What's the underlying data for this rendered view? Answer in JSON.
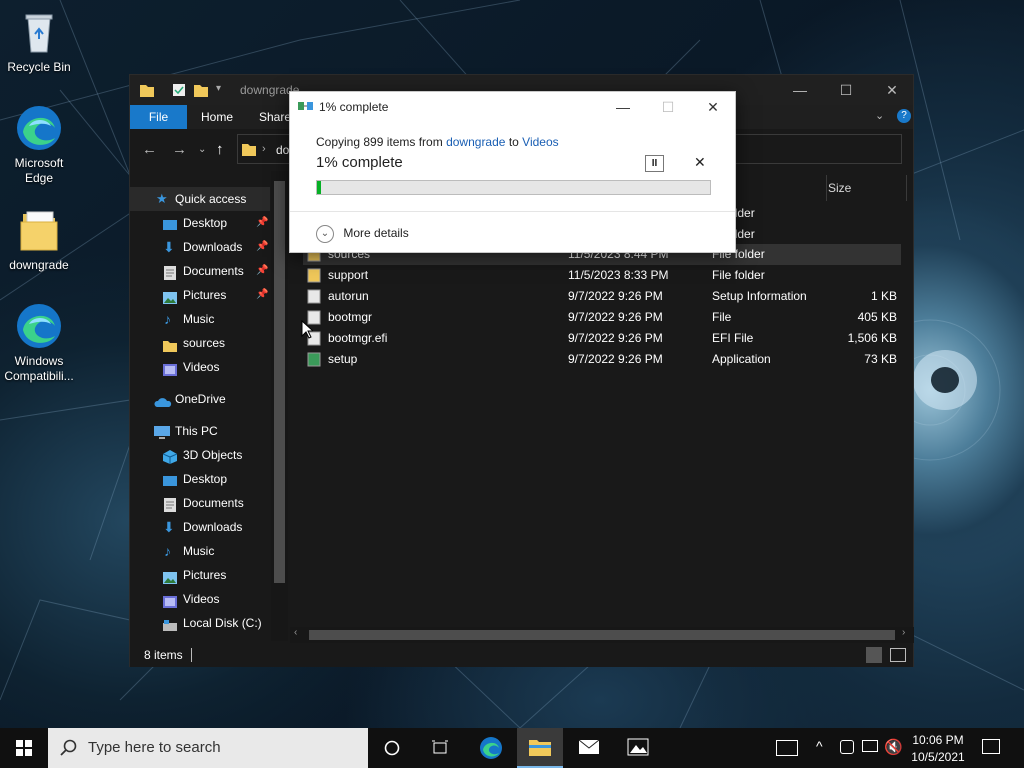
{
  "desktop": {
    "icons": [
      {
        "label": "Recycle Bin"
      },
      {
        "label": "Microsoft Edge"
      },
      {
        "label": "downgrade"
      },
      {
        "label": "Windows Compatibili..."
      }
    ]
  },
  "explorer": {
    "title": "downgrade",
    "address_partial": "do",
    "tabs": {
      "file": "File",
      "home": "Home",
      "share": "Share"
    },
    "columns": {
      "size": "Size"
    },
    "nav": {
      "quick_access": "Quick access",
      "qa_items": [
        "Desktop",
        "Downloads",
        "Documents",
        "Pictures",
        "Music",
        "sources",
        "Videos"
      ],
      "onedrive": "OneDrive",
      "this_pc": "This PC",
      "pc_items": [
        "3D Objects",
        "Desktop",
        "Documents",
        "Downloads",
        "Music",
        "Pictures",
        "Videos",
        "Local Disk (C:)"
      ]
    },
    "partial_rows": [
      {
        "type": "folder"
      },
      {
        "type": "folder"
      }
    ],
    "files": [
      {
        "name": "sources",
        "date": "11/5/2023 8:44 PM",
        "type": "File folder",
        "size": "",
        "icon": "folder-icon"
      },
      {
        "name": "support",
        "date": "11/5/2023 8:33 PM",
        "type": "File folder",
        "size": "",
        "icon": "folder-icon"
      },
      {
        "name": "autorun",
        "date": "9/7/2022 9:26 PM",
        "type": "Setup Information",
        "size": "1 KB",
        "icon": "setup-info-icon"
      },
      {
        "name": "bootmgr",
        "date": "9/7/2022 9:26 PM",
        "type": "File",
        "size": "405 KB",
        "icon": "file-icon"
      },
      {
        "name": "bootmgr.efi",
        "date": "9/7/2022 9:26 PM",
        "type": "EFI File",
        "size": "1,506 KB",
        "icon": "file-icon"
      },
      {
        "name": "setup",
        "date": "9/7/2022 9:26 PM",
        "type": "Application",
        "size": "73 KB",
        "icon": "setup-app-icon"
      }
    ],
    "status_items": "8 items"
  },
  "dialog": {
    "title": "1% complete",
    "copying_prefix": "Copying 899 items from",
    "from": "downgrade",
    "to_word": "to",
    "to": "Videos",
    "percent_text": "1% complete",
    "progress": 0.01,
    "more_details": "More details"
  },
  "taskbar": {
    "search_placeholder": "Type here to search",
    "time": "10:06 PM",
    "date": "10/5/2021"
  }
}
